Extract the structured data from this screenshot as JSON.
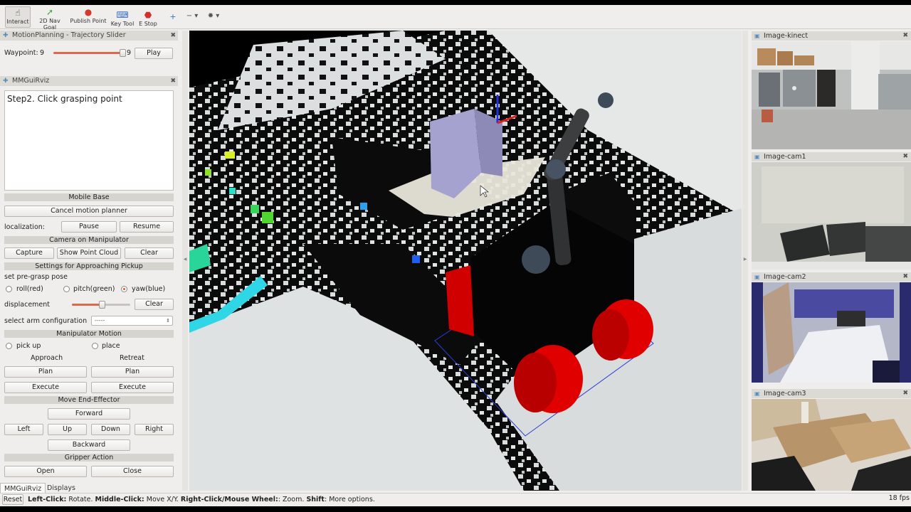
{
  "toolbar": {
    "tools": [
      {
        "label": "Interact",
        "icon": "hand-icon"
      },
      {
        "label": "2D Nav Goal",
        "icon": "green-arrow-icon"
      },
      {
        "label": "Publish Point",
        "icon": "map-pin-icon"
      },
      {
        "label": "Key Tool",
        "icon": "keyboard-icon"
      },
      {
        "label": "E Stop",
        "icon": "stop-sign-icon"
      }
    ]
  },
  "trajectory_panel": {
    "title": "MotionPlanning - Trajectory Slider",
    "waypoint_label": "Waypoint:",
    "waypoint_value": "9",
    "waypoint_max": "9",
    "waypoint_fraction": 1.0,
    "play_label": "Play"
  },
  "mmgui_panel": {
    "title": "MMGuiRviz",
    "instruction_text": "Step2. Click grasping point",
    "mobile_base_header": "Mobile Base",
    "cancel_motion_planner_label": "Cancel motion planner",
    "localization_label": "localization:",
    "pause_label": "Pause",
    "resume_label": "Resume",
    "camera_header": "Camera on Manipulator",
    "capture_label": "Capture",
    "show_point_cloud_label": "Show Point Cloud",
    "clear_label": "Clear",
    "settings_header": "Settings for Approaching Pickup",
    "set_pregrasp_label": "set pre-grasp pose",
    "roll_label": "roll(red)",
    "pitch_label": "pitch(green)",
    "yaw_label": "yaw(blue)",
    "selected_axis": "yaw(blue)",
    "displacement_label": "displacement",
    "displacement_fraction": 0.52,
    "displacement_clear_label": "Clear",
    "select_arm_label": "select arm configuration",
    "arm_config_value": "-----",
    "manipulator_header": "Manipulator Motion",
    "pick_up_label": "pick up",
    "place_label": "place",
    "approach_label": "Approach",
    "retreat_label": "Retreat",
    "plan_label": "Plan",
    "execute_label": "Execute",
    "end_effector_header": "Move End-Effector",
    "forward_label": "Forward",
    "left_label": "Left",
    "up_label": "Up",
    "down_label": "Down",
    "right_label": "Right",
    "backward_label": "Backward",
    "gripper_header": "Gripper Action",
    "open_label": "Open",
    "close_label": "Close"
  },
  "bottom_tabs": [
    "MMGuiRviz",
    "Displays"
  ],
  "cameras": [
    {
      "title": "Image-kinect"
    },
    {
      "title": "Image-cam1"
    },
    {
      "title": "Image-cam2"
    },
    {
      "title": "Image-cam3"
    }
  ],
  "status_bar": {
    "reset_label": "Reset",
    "left_click_key": "Left-Click:",
    "left_click_desc": "Rotate.",
    "middle_click_key": "Middle-Click:",
    "middle_click_desc": "Move X/Y.",
    "right_click_key": "Right-Click/Mouse Wheel:",
    "right_click_desc": ": Zoom.",
    "shift_key": "Shift",
    "shift_desc": ": More options.",
    "fps": "18 fps"
  },
  "colors": {
    "accent_slider": "#e2664a",
    "robot_wheels": "#e00000",
    "nav_frame": "#2a3cd8"
  }
}
